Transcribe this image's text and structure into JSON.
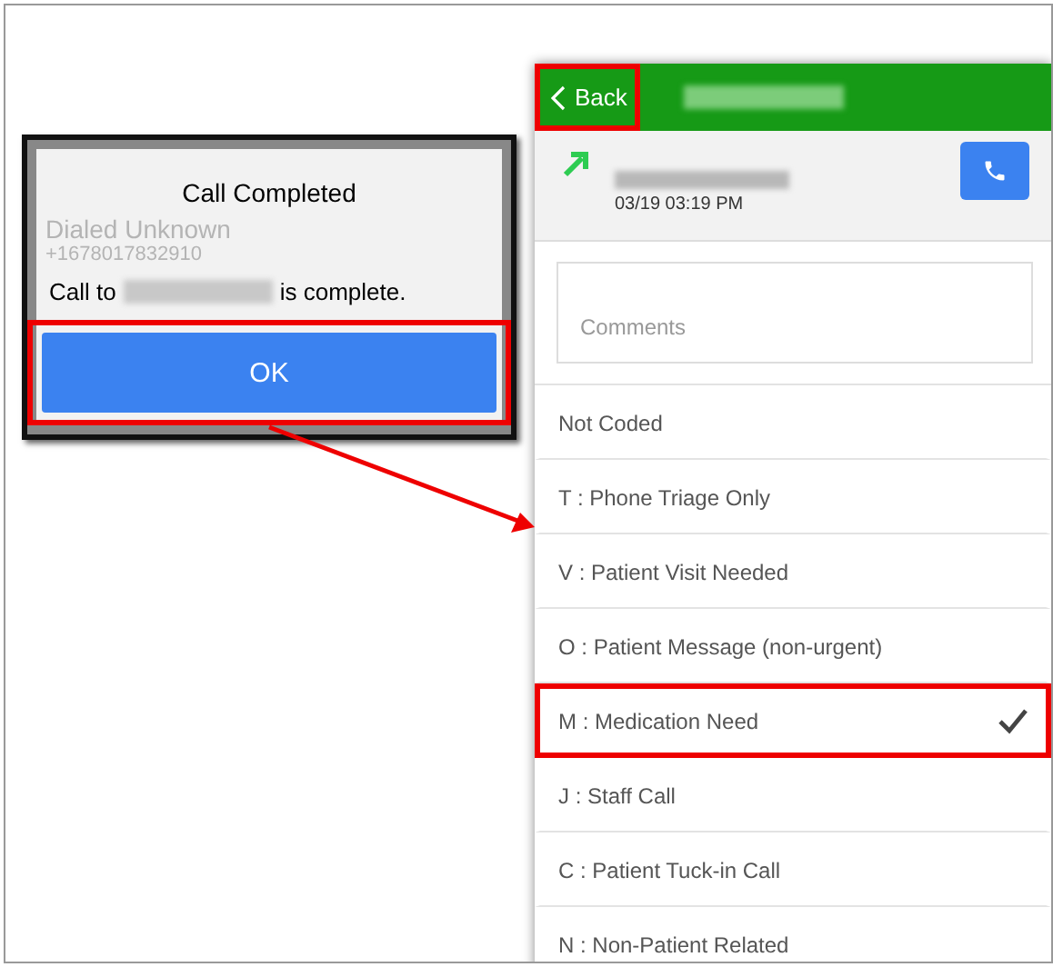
{
  "background": {
    "texts": [
      "Dialed Unknown",
      "+1678017832910"
    ]
  },
  "dialog": {
    "title": "Call Completed",
    "message_before": "Call to",
    "message_after": "is complete.",
    "button": "OK",
    "highlighted": true
  },
  "phone": {
    "back": {
      "label": "Back",
      "highlighted": true
    },
    "time": "03/19 03:19 PM",
    "comments": {
      "placeholder": "Comments"
    },
    "codes": [
      {
        "label": "Not Coded",
        "selected": false
      },
      {
        "label": "T : Phone Triage Only",
        "selected": false
      },
      {
        "label": "V : Patient Visit Needed",
        "selected": false
      },
      {
        "label": "O : Patient Message (non-urgent)",
        "selected": false
      },
      {
        "label": "M : Medication Need",
        "selected": true
      },
      {
        "label": "J : Staff Call",
        "selected": false
      },
      {
        "label": "C : Patient Tuck-in Call",
        "selected": false
      },
      {
        "label": "N : Non-Patient Related",
        "selected": false
      }
    ]
  }
}
